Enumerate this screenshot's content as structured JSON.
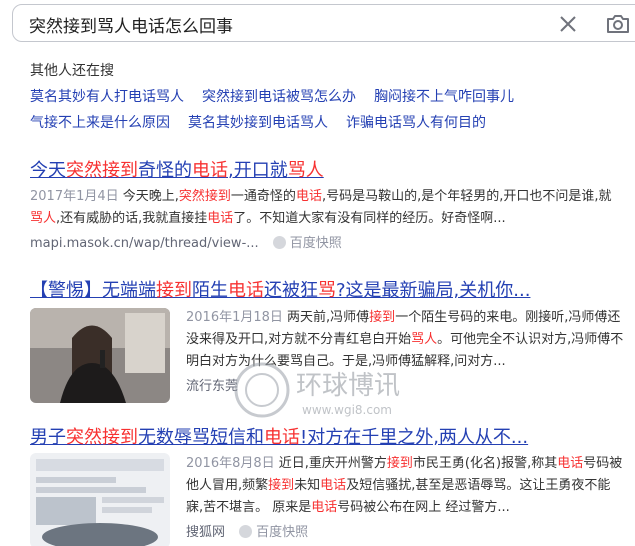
{
  "search": {
    "query": "突然接到骂人电话怎么回事"
  },
  "icons": {
    "clear": "close-icon",
    "camera": "camera-icon",
    "cache": "snapshot-icon"
  },
  "related": {
    "title": "其他人还在搜",
    "row1": [
      "莫名其妙有人打电话骂人",
      "突然接到电话被骂怎么办",
      "胸闷接不上气咋回事儿"
    ],
    "row2": [
      "气接不上来是什么原因",
      "莫名其妙接到电话骂人",
      "诈骗电话骂人有何目的"
    ]
  },
  "results": [
    {
      "title_parts": [
        "今天",
        "突然接到",
        "奇怪的",
        "电话",
        ",开口就",
        "骂人"
      ],
      "date": "2017年1月4日",
      "snippet_parts": [
        " 今天晚上,",
        "突然接到",
        "一通奇怪的",
        "电话",
        ",号码是马鞍山的,是个年轻男的,开口也不问是谁,就",
        "骂人",
        ",还有威胁的话,我就直接挂",
        "电话",
        "了。不知道大家有没有同样的经历。好奇怪啊..."
      ],
      "source": "mapi.masok.cn/wap/thread/view-...",
      "cache": "百度快照"
    },
    {
      "title_parts": [
        "【警惕】无端端",
        "接到",
        "陌生",
        "电话",
        "还被狂",
        "骂",
        "?这是最新骗局,关机你..."
      ],
      "date": "2016年1月18日",
      "snippet_parts": [
        " 两天前,冯师傅",
        "接到",
        "一个陌生号码的来电。刚接听,冯师傅还没来得及开口,对方就不分青红皂白开始",
        "骂人",
        "。可他完全不认识对方,冯师傅不明白对方为什么要骂自己。于是,冯师傅猛解释,问对方..."
      ],
      "source": "流行东莞",
      "cache": "百度快照"
    },
    {
      "title_parts": [
        "男子",
        "突然接到",
        "无数辱骂短信和",
        "电话",
        "!对方在千里之外,两人从不..."
      ],
      "date": "2016年8月8日",
      "snippet_parts": [
        " 近日,重庆开州警方",
        "接到",
        "市民王勇(化名)报警,称其",
        "电话",
        "号码被他人冒用,频繁",
        "接到",
        "未知",
        "电话",
        "及短信骚扰,甚至是恶语辱骂。这让王勇夜不能寐,苦不堪言。 原来是",
        "电话",
        "号码被公布在网上 经过警方..."
      ],
      "source": "搜狐网",
      "cache": "百度快照"
    }
  ],
  "watermark": {
    "main": "环球博讯",
    "url": "www.wgi8.com"
  }
}
